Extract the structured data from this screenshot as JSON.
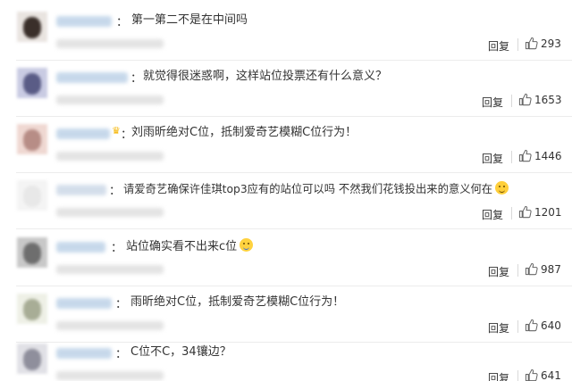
{
  "comments": [
    {
      "vip": false,
      "text": "第一第二不是在中间吗",
      "emoji": "",
      "reply_label": "回复",
      "likes": "293",
      "avatar_colors": [
        "#e9e4e0",
        "#3a2f2a"
      ]
    },
    {
      "vip": false,
      "text": "就觉得很迷惑啊，这样站位投票还有什么意义？",
      "emoji": "",
      "reply_label": "回复",
      "likes": "1653",
      "avatar_colors": [
        "#c9cbe3",
        "#5a5c86"
      ]
    },
    {
      "vip": true,
      "text": "刘雨昕绝对C位，抵制爱奇艺模糊C位行为！",
      "emoji": "",
      "reply_label": "回复",
      "likes": "1446",
      "avatar_colors": [
        "#efd8d2",
        "#b78d86"
      ]
    },
    {
      "vip": false,
      "text": "请爱奇艺确保许佳琪top3应有的站位可以吗 不然我们花钱投出来的意义何在",
      "emoji": "smile-emoji",
      "reply_label": "回复",
      "likes": "1201",
      "avatar_colors": [
        "#f4f4f4",
        "#e8e8e8"
      ]
    },
    {
      "vip": false,
      "text": "站位确实看不出来c位",
      "emoji": "tear-laugh-emoji",
      "reply_label": "回复",
      "likes": "987",
      "avatar_colors": [
        "#c8c8c8",
        "#6e6e6e"
      ]
    },
    {
      "vip": false,
      "text": "雨昕绝对C位，抵制爱奇艺模糊C位行为！",
      "emoji": "",
      "reply_label": "回复",
      "likes": "640",
      "avatar_colors": [
        "#eef0e6",
        "#a8ad96"
      ]
    },
    {
      "vip": false,
      "text": "C位不C，34镶边？",
      "emoji": "",
      "reply_label": "回复",
      "likes": "641",
      "avatar_colors": [
        "#e1e1e6",
        "#8f8f9c"
      ]
    }
  ],
  "icons": {
    "like": "thumbs-up-icon",
    "vip": "crown-icon"
  },
  "colors": {
    "name_blur": "#b9cfe6",
    "vip": "#f5b400",
    "text": "#333333"
  }
}
